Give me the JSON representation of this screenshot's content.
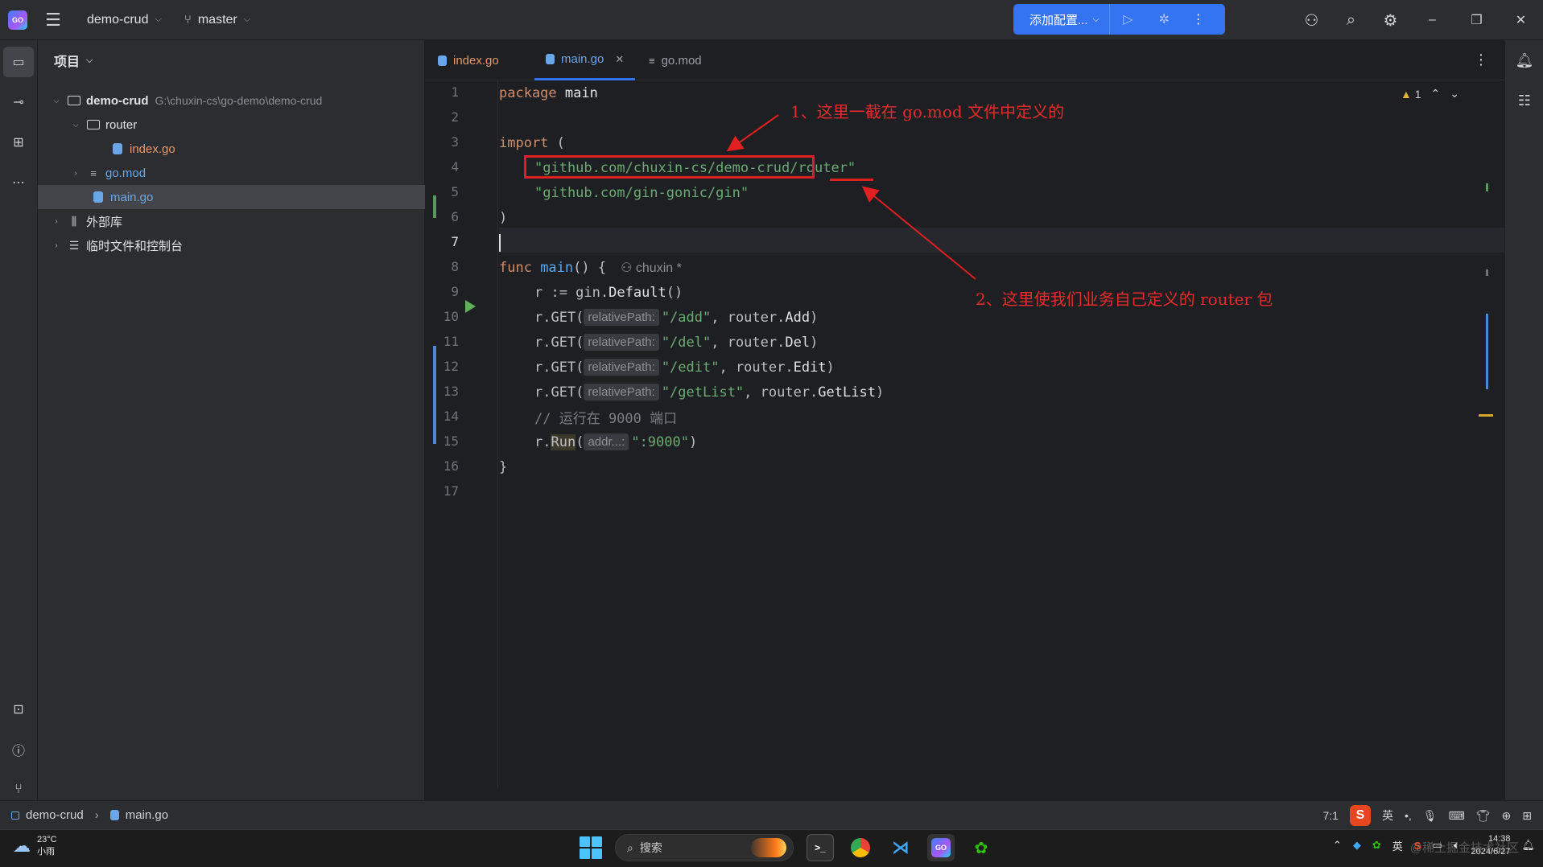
{
  "titlebar": {
    "project_name": "demo-crud",
    "branch_name": "master",
    "run_config_label": "添加配置..."
  },
  "project_panel": {
    "title": "项目",
    "tree": [
      {
        "label": "demo-crud",
        "path": "G:\\chuxin-cs\\go-demo\\demo-crud"
      },
      {
        "label": "router"
      },
      {
        "label": "index.go"
      },
      {
        "label": "go.mod"
      },
      {
        "label": "main.go"
      },
      {
        "label": "外部库"
      },
      {
        "label": "临时文件和控制台"
      }
    ]
  },
  "tabs": [
    {
      "label": "index.go"
    },
    {
      "label": "main.go"
    },
    {
      "label": "go.mod"
    }
  ],
  "editor": {
    "line_numbers": [
      "1",
      "2",
      "3",
      "4",
      "5",
      "6",
      "7",
      "8",
      "9",
      "10",
      "11",
      "12",
      "13",
      "14",
      "15",
      "16",
      "17"
    ],
    "warning_count": "1",
    "code": {
      "l1_kw": "package",
      "l1_name": " main",
      "l3_kw": "import",
      "l3_paren": " (",
      "l4_import_prefix": "\"github.com/chuxin-cs/demo-crud",
      "l4_import_suffix": "/router\"",
      "l5_import": "\"github.com/gin-gonic/gin\"",
      "l6": ")",
      "l8_kw": "func",
      "l8_name": " main",
      "l8_rest": "() {",
      "l8_author": "chuxin *",
      "l9_prefix": "r := gin.",
      "l9_fn": "Default",
      "l9_suffix": "()",
      "route_call": "r.GET(",
      "param_hint": "relativePath:",
      "routes": [
        {
          "path": "\"/add\"",
          "handler_pkg": ", router.",
          "handler": "Add"
        },
        {
          "path": "\"/del\"",
          "handler_pkg": ", router.",
          "handler": "Del"
        },
        {
          "path": "\"/edit\"",
          "handler_pkg": ", router.",
          "handler": "Edit"
        },
        {
          "path": "\"/getList\"",
          "handler_pkg": ", router.",
          "handler": "GetList"
        }
      ],
      "l14_comment": "// 运行在 9000 端口",
      "l15_prefix": "r.",
      "l15_fn": "Run",
      "l15_paren": "(",
      "l15_hint": "addr...:",
      "l15_arg": "\":9000\"",
      "l15_close": ")",
      "l16": "}"
    }
  },
  "annotations": {
    "note1": "1、这里一截在 go.mod 文件中定义的",
    "note2": "2、这里使我们业务自己定义的 router 包"
  },
  "statusbar": {
    "crumbs": [
      "demo-crud",
      "main.go"
    ],
    "position": "7:1",
    "ime_mode": "英"
  },
  "taskbar": {
    "weather_temp": "23°C",
    "weather_desc": "小雨",
    "search_placeholder": "搜索",
    "tray_lang": "英",
    "time": "14:38",
    "date": "2024/6/27",
    "watermark": "@稀土掘金技术社区"
  }
}
